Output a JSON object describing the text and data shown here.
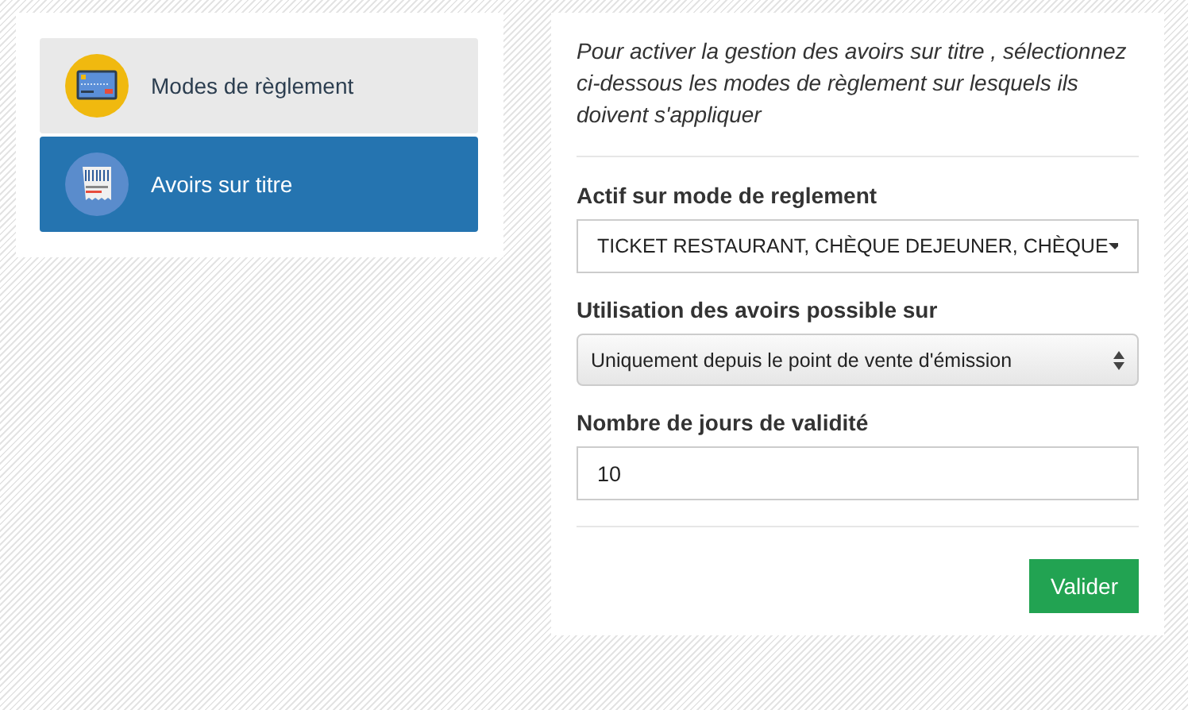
{
  "sidebar": {
    "items": [
      {
        "label": "Modes de règlement",
        "kind": "card",
        "selected": false
      },
      {
        "label": "Avoirs sur titre",
        "kind": "receipt",
        "selected": true
      }
    ]
  },
  "form": {
    "intro": "Pour activer la gestion des avoirs sur titre , sélectionnez ci-dessous les modes de règlement sur lesquels ils doivent s'appliquer",
    "fields": [
      {
        "label": "Actif sur mode de reglement",
        "kind": "multiselect",
        "value": "TICKET RESTAURANT, CHÈQUE DEJEUNER, CHÈQUE"
      },
      {
        "label": "Utilisation des avoirs possible sur",
        "kind": "select",
        "value": "Uniquement depuis le point de vente d'émission"
      },
      {
        "label": "Nombre de jours de validité",
        "kind": "text",
        "value": "10"
      }
    ],
    "submit": "Valider"
  }
}
